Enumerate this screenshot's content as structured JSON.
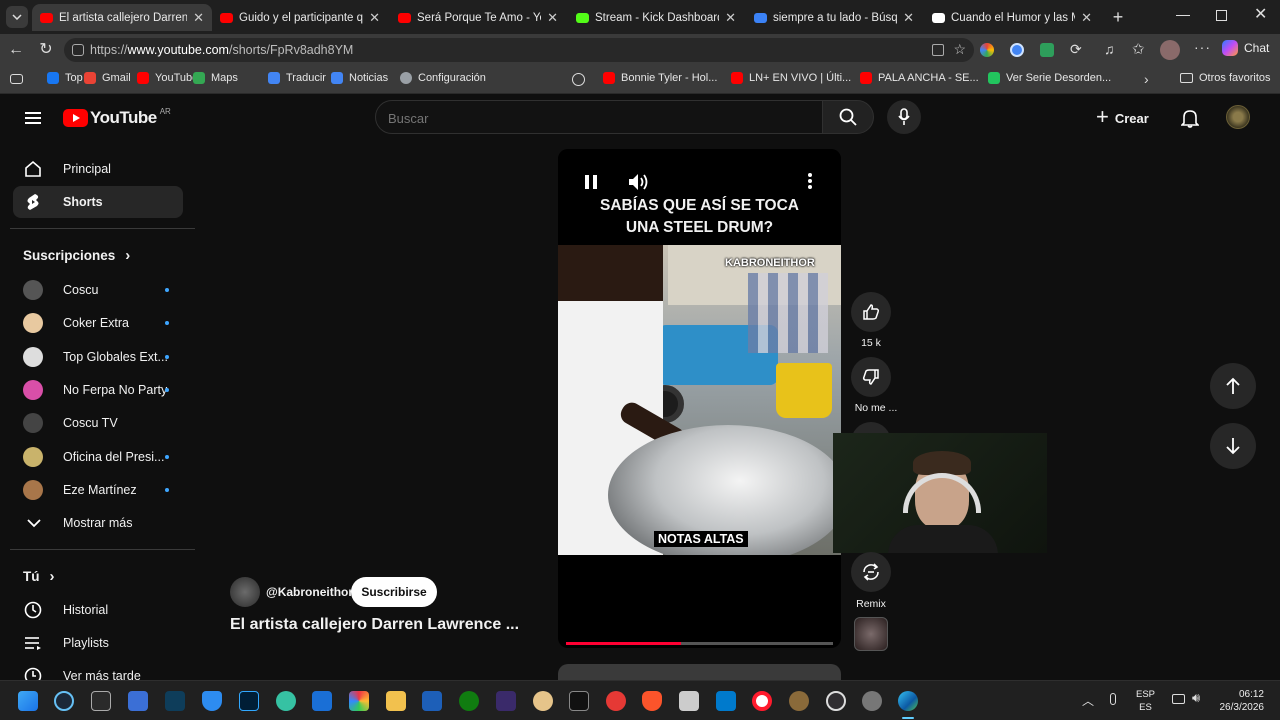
{
  "browser": {
    "tabs": [
      {
        "label": "El artista callejero Darren",
        "color": "#ff0000"
      },
      {
        "label": "Guido y el participante que e",
        "color": "#ff0000"
      },
      {
        "label": "Será Porque Te Amo - YouTub",
        "color": "#ff0000"
      },
      {
        "label": "Stream - Kick Dashboard",
        "color": "#53fc18"
      },
      {
        "label": "siempre a tu lado - Búsqueda",
        "color": "#3b82f6"
      },
      {
        "label": "Cuando el Humor y las Mate",
        "color": "#ffffff"
      }
    ],
    "url_prefix": "https://",
    "url_host": "www.youtube.com",
    "url_path": "/shorts/FpRv8adh8YM",
    "chat_label": "Chat",
    "bookmarks": [
      {
        "label": "Top",
        "color": "#1877f2"
      },
      {
        "label": "Gmail",
        "color": "#ea4335"
      },
      {
        "label": "YouTube",
        "color": "#ff0000"
      },
      {
        "label": "Maps",
        "color": "#34a853"
      },
      {
        "label": "Traducir",
        "color": "#4285f4"
      },
      {
        "label": "Noticias",
        "color": "#4285f4"
      },
      {
        "label": "Configuración",
        "color": "#9aa0a6"
      },
      {
        "label": "Bonnie Tyler - Hol...",
        "color": "#ff0000"
      },
      {
        "label": "LN+ EN VIVO | Últi...",
        "color": "#ff0000"
      },
      {
        "label": "PALA ANCHA - SE...",
        "color": "#ff0000"
      },
      {
        "label": "Ver Serie Desorden...",
        "color": "#22c55e"
      }
    ],
    "other_favorites": "Otros favoritos"
  },
  "youtube": {
    "logo_text": "YouTube",
    "region": "AR",
    "search_placeholder": "Buscar",
    "create_label": "Crear",
    "sidebar": {
      "main": [
        {
          "label": "Principal"
        },
        {
          "label": "Shorts"
        }
      ],
      "subs_header": "Suscripciones",
      "subscriptions": [
        {
          "label": "Coscu",
          "color": "#555555",
          "dot": true
        },
        {
          "label": "Coker Extra",
          "color": "#e8c9a0",
          "dot": true
        },
        {
          "label": "Top Globales Ext...",
          "color": "#dddddd",
          "dot": true
        },
        {
          "label": "No Ferpa No Party",
          "color": "#d94fa8",
          "dot": true
        },
        {
          "label": "Coscu TV",
          "color": "#444444",
          "dot": false
        },
        {
          "label": "Oficina del Presi...",
          "color": "#c9b36b",
          "dot": true
        },
        {
          "label": "Eze Martínez",
          "color": "#a8764a",
          "dot": true
        }
      ],
      "show_more": "Mostrar más",
      "you_header": "Tú",
      "you_items": [
        {
          "label": "Historial"
        },
        {
          "label": "Playlists"
        },
        {
          "label": "Ver más tarde"
        }
      ]
    },
    "short": {
      "caption_line1": "SABÍAS QUE ASÍ SE TOCA",
      "caption_line2": "UNA STEEL DRUM?",
      "watermark": "KABRONEITHOR",
      "subtitle": "NOTAS ALTAS",
      "channel": "@Kabroneithor",
      "subscribe": "Suscribirse",
      "title": "El artista callejero Darren Lawrence ...",
      "progress": 0.43,
      "likes": "15 k",
      "dislike": "No me ...",
      "remix": "Remix"
    }
  },
  "taskbar": {
    "lang1": "ESP",
    "lang2": "ES",
    "time": "06:12",
    "date": "26/3/2026"
  }
}
